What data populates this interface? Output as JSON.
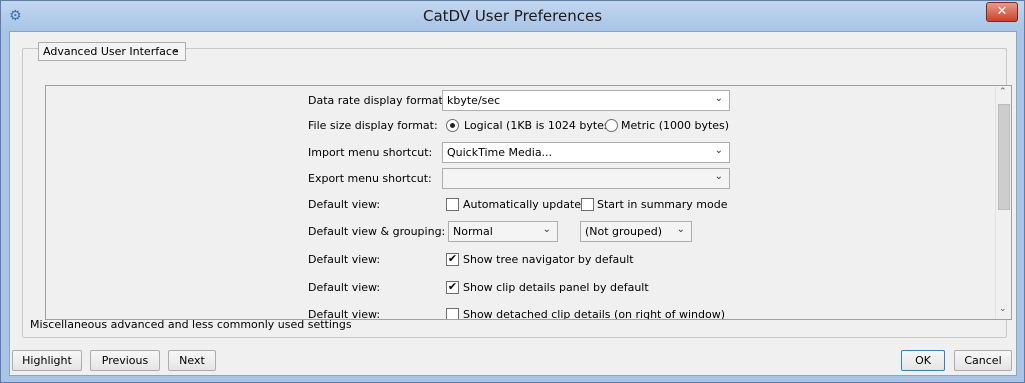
{
  "window": {
    "title": "CatDV User Preferences"
  },
  "category": {
    "selected": "Advanced User Interface"
  },
  "settings": {
    "data_rate": {
      "label": "Data rate display format:",
      "value": "kbyte/sec"
    },
    "file_size": {
      "label": "File size display format:",
      "options": [
        "Logical (1KB is 1024 bytes)",
        "Metric (1000 bytes)"
      ],
      "selected": 0
    },
    "import_shortcut": {
      "label": "Import menu shortcut:",
      "value": "QuickTime Media..."
    },
    "export_shortcut": {
      "label": "Export menu shortcut:",
      "value": ""
    },
    "default_view_1": {
      "label": "Default view:",
      "options": [
        {
          "text": "Automatically update",
          "checked": false
        },
        {
          "text": "Start in summary mode",
          "checked": false
        }
      ]
    },
    "view_grouping": {
      "label": "Default view & grouping:",
      "view": "Normal",
      "grouping": "(Not grouped)"
    },
    "default_view_2": {
      "label": "Default view:",
      "option": "Show tree navigator by default",
      "checked": true
    },
    "default_view_3": {
      "label": "Default view:",
      "option": "Show clip details panel by default",
      "checked": true
    },
    "default_view_4": {
      "label": "Default view:",
      "option": "Show detached clip details (on right of window)",
      "checked": false
    }
  },
  "description": "Miscellaneous advanced and less commonly used settings",
  "buttons": {
    "highlight": "Highlight",
    "previous": "Previous",
    "next": "Next",
    "ok": "OK",
    "cancel": "Cancel"
  },
  "icons": {
    "close": "close-icon",
    "dropdown": "chevron-down-icon",
    "app": "app-icon"
  }
}
